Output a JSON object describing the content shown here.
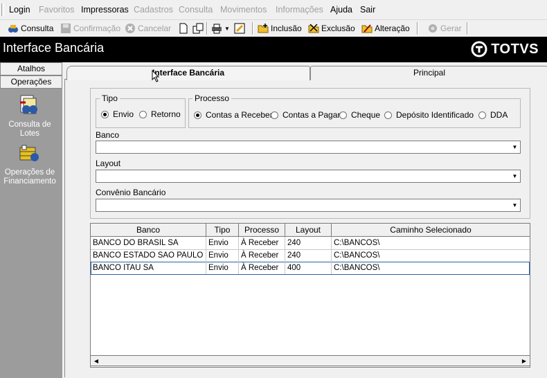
{
  "menu": {
    "items": [
      {
        "label": "Login",
        "enabled": true
      },
      {
        "label": "Favoritos",
        "enabled": false
      },
      {
        "label": "Impressoras",
        "enabled": true
      },
      {
        "label": "Cadastros",
        "enabled": false
      },
      {
        "label": "Consulta",
        "enabled": false
      },
      {
        "label": "Movimentos",
        "enabled": false
      },
      {
        "label": "Informações",
        "enabled": false
      },
      {
        "label": "Ajuda",
        "enabled": true
      },
      {
        "label": "Sair",
        "enabled": true
      }
    ]
  },
  "toolbar": {
    "consulta": "Consulta",
    "confirmacao": "Confirmação",
    "cancelar": "Cancelar",
    "inclusao": "Inclusão",
    "exclusao": "Exclusão",
    "alteracao": "Alteração",
    "gerar": "Gerar"
  },
  "header": {
    "title": "Interface Bancária",
    "logo": "TOTVS"
  },
  "sidebar": {
    "tabs": [
      "Atalhos",
      "Operações"
    ],
    "links": [
      {
        "label": "Consulta de Lotes",
        "icon": "batch-query-icon"
      },
      {
        "label": "Operações de Financiamento",
        "icon": "financing-icon"
      }
    ]
  },
  "tabs": {
    "active": "Interface Bancária",
    "other": "Principal"
  },
  "form": {
    "tipo": {
      "legend": "Tipo",
      "options": [
        "Envio",
        "Retorno"
      ],
      "selected": "Envio"
    },
    "processo": {
      "legend": "Processo",
      "options": [
        "Contas a Receber",
        "Contas a Pagar",
        "Cheque",
        "Depósito Identificado",
        "DDA"
      ],
      "selected": "Contas a Receber"
    },
    "banco_label": "Banco",
    "layout_label": "Layout",
    "convenio_label": "Convênio Bancário"
  },
  "grid": {
    "columns": [
      "Banco",
      "Tipo",
      "Processo",
      "Layout",
      "Caminho Selecionado"
    ],
    "rows": [
      [
        "BANCO DO BRASIL SA",
        "Envio",
        "À Receber",
        "240",
        "C:\\BANCOS\\"
      ],
      [
        "BANCO ESTADO SAO PAULO ...",
        "Envio",
        "À Receber",
        "240",
        "C:\\BANCOS\\"
      ],
      [
        "BANCO ITAU SA",
        "Envio",
        "À Receber",
        "400",
        "C:\\BANCOS\\"
      ]
    ],
    "selected_row": 2
  }
}
